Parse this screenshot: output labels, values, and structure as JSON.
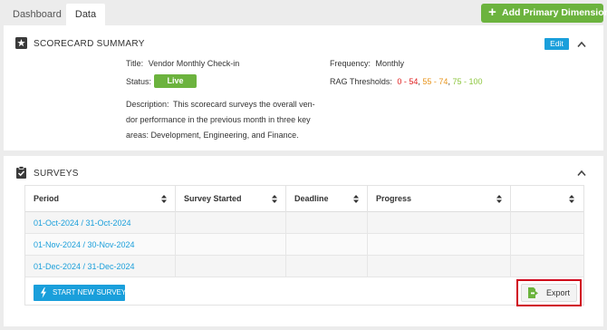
{
  "tabs": [
    {
      "label": "Dashboard",
      "active": false
    },
    {
      "label": "Data",
      "active": true
    }
  ],
  "add_dimension_label": "Add Primary Dimension",
  "summary": {
    "title": "SCORECARD SUMMARY",
    "icon": "star-icon",
    "edit_label": "Edit",
    "title_label": "Title:",
    "title_value": "Vendor Monthly Check-in",
    "status_label": "Status:",
    "status_value": "Live",
    "description_label": "Description:",
    "description_value": "This scorecard surveys the overall ven-dor performance in the previous month in three key areas: Development, Engineering, and Finance.",
    "frequency_label": "Frequency:",
    "frequency_value": "Monthly",
    "rag_label": "RAG Thresholds:",
    "rag_red": "0 - 54",
    "rag_orange": "55 - 74",
    "rag_green": "75 - 100",
    "sep": ", "
  },
  "surveys": {
    "title": "SURVEYS",
    "icon": "clipboard-check-icon",
    "columns": [
      "Period",
      "Survey Started",
      "Deadline",
      "Progress",
      ""
    ],
    "rows": [
      {
        "period": "01-Oct-2024 / 31-Oct-2024",
        "started": "",
        "deadline": "",
        "progress": ""
      },
      {
        "period": "01-Nov-2024 / 30-Nov-2024",
        "started": "",
        "deadline": "",
        "progress": ""
      },
      {
        "period": "01-Dec-2024 / 31-Dec-2024",
        "started": "",
        "deadline": "",
        "progress": ""
      }
    ],
    "start_label": "START NEW SURVEY",
    "export_label": "Export"
  },
  "colors": {
    "accent_blue": "#1a9fdb",
    "accent_green": "#6cb33e",
    "rag_red": "#e02020",
    "rag_orange": "#e8951d",
    "rag_green": "#8dc63f",
    "highlight_red": "#d0021b"
  }
}
